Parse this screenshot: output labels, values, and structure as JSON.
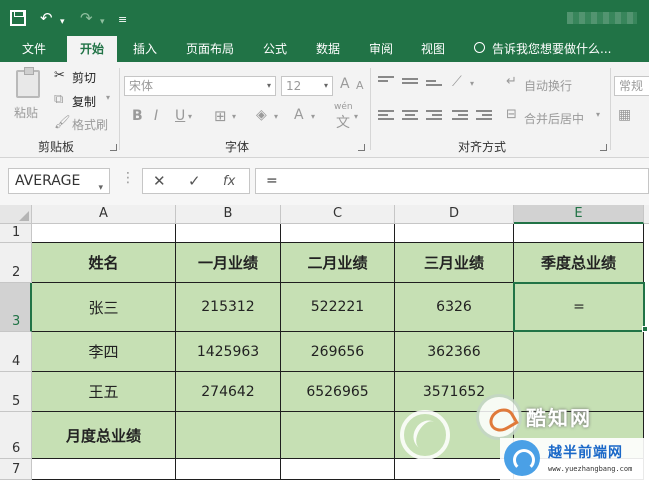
{
  "quick_access": {
    "undo": "↶",
    "redo": "↷",
    "more": "≡"
  },
  "tabs": [
    {
      "label": "文件"
    },
    {
      "label": "开始"
    },
    {
      "label": "插入"
    },
    {
      "label": "页面布局"
    },
    {
      "label": "公式"
    },
    {
      "label": "数据"
    },
    {
      "label": "审阅"
    },
    {
      "label": "视图"
    }
  ],
  "tell_me": "告诉我您想要做什么...",
  "ribbon": {
    "clipboard": {
      "paste": "粘贴",
      "cut": "剪切",
      "copy": "复制",
      "format_painter": "格式刷",
      "label": "剪贴板"
    },
    "font": {
      "name": "宋体",
      "size": "12",
      "bold": "B",
      "italic": "I",
      "underline": "U",
      "font_color": "A",
      "larger": "A",
      "smaller": "A",
      "phonetic": "wén",
      "label": "字体"
    },
    "alignment": {
      "wrap": "自动换行",
      "merge": "合并后居中",
      "label": "对齐方式"
    },
    "number": {
      "format": "常规"
    }
  },
  "formula_bar": {
    "name_box": "AVERAGE",
    "cancel": "✕",
    "enter": "✓",
    "fx": "fx",
    "content": "="
  },
  "columns": [
    "A",
    "B",
    "C",
    "D",
    "E"
  ],
  "rows": [
    "1",
    "2",
    "3",
    "4",
    "5",
    "6",
    "7"
  ],
  "table": {
    "headers": [
      "姓名",
      "一月业绩",
      "二月业绩",
      "三月业绩",
      "季度总业绩"
    ],
    "rows": [
      {
        "name": "张三",
        "values": [
          "215312",
          "522221",
          "6326"
        ],
        "total": "="
      },
      {
        "name": "李四",
        "values": [
          "1425963",
          "269656",
          "362366"
        ],
        "total": ""
      },
      {
        "name": "王五",
        "values": [
          "274642",
          "6526965",
          "3571652"
        ],
        "total": ""
      }
    ],
    "footer": "月度总业绩"
  },
  "watermarks": {
    "brand1": "酷知网",
    "brand2": "越半前端网",
    "url": "www.yuezhangbang.com"
  }
}
